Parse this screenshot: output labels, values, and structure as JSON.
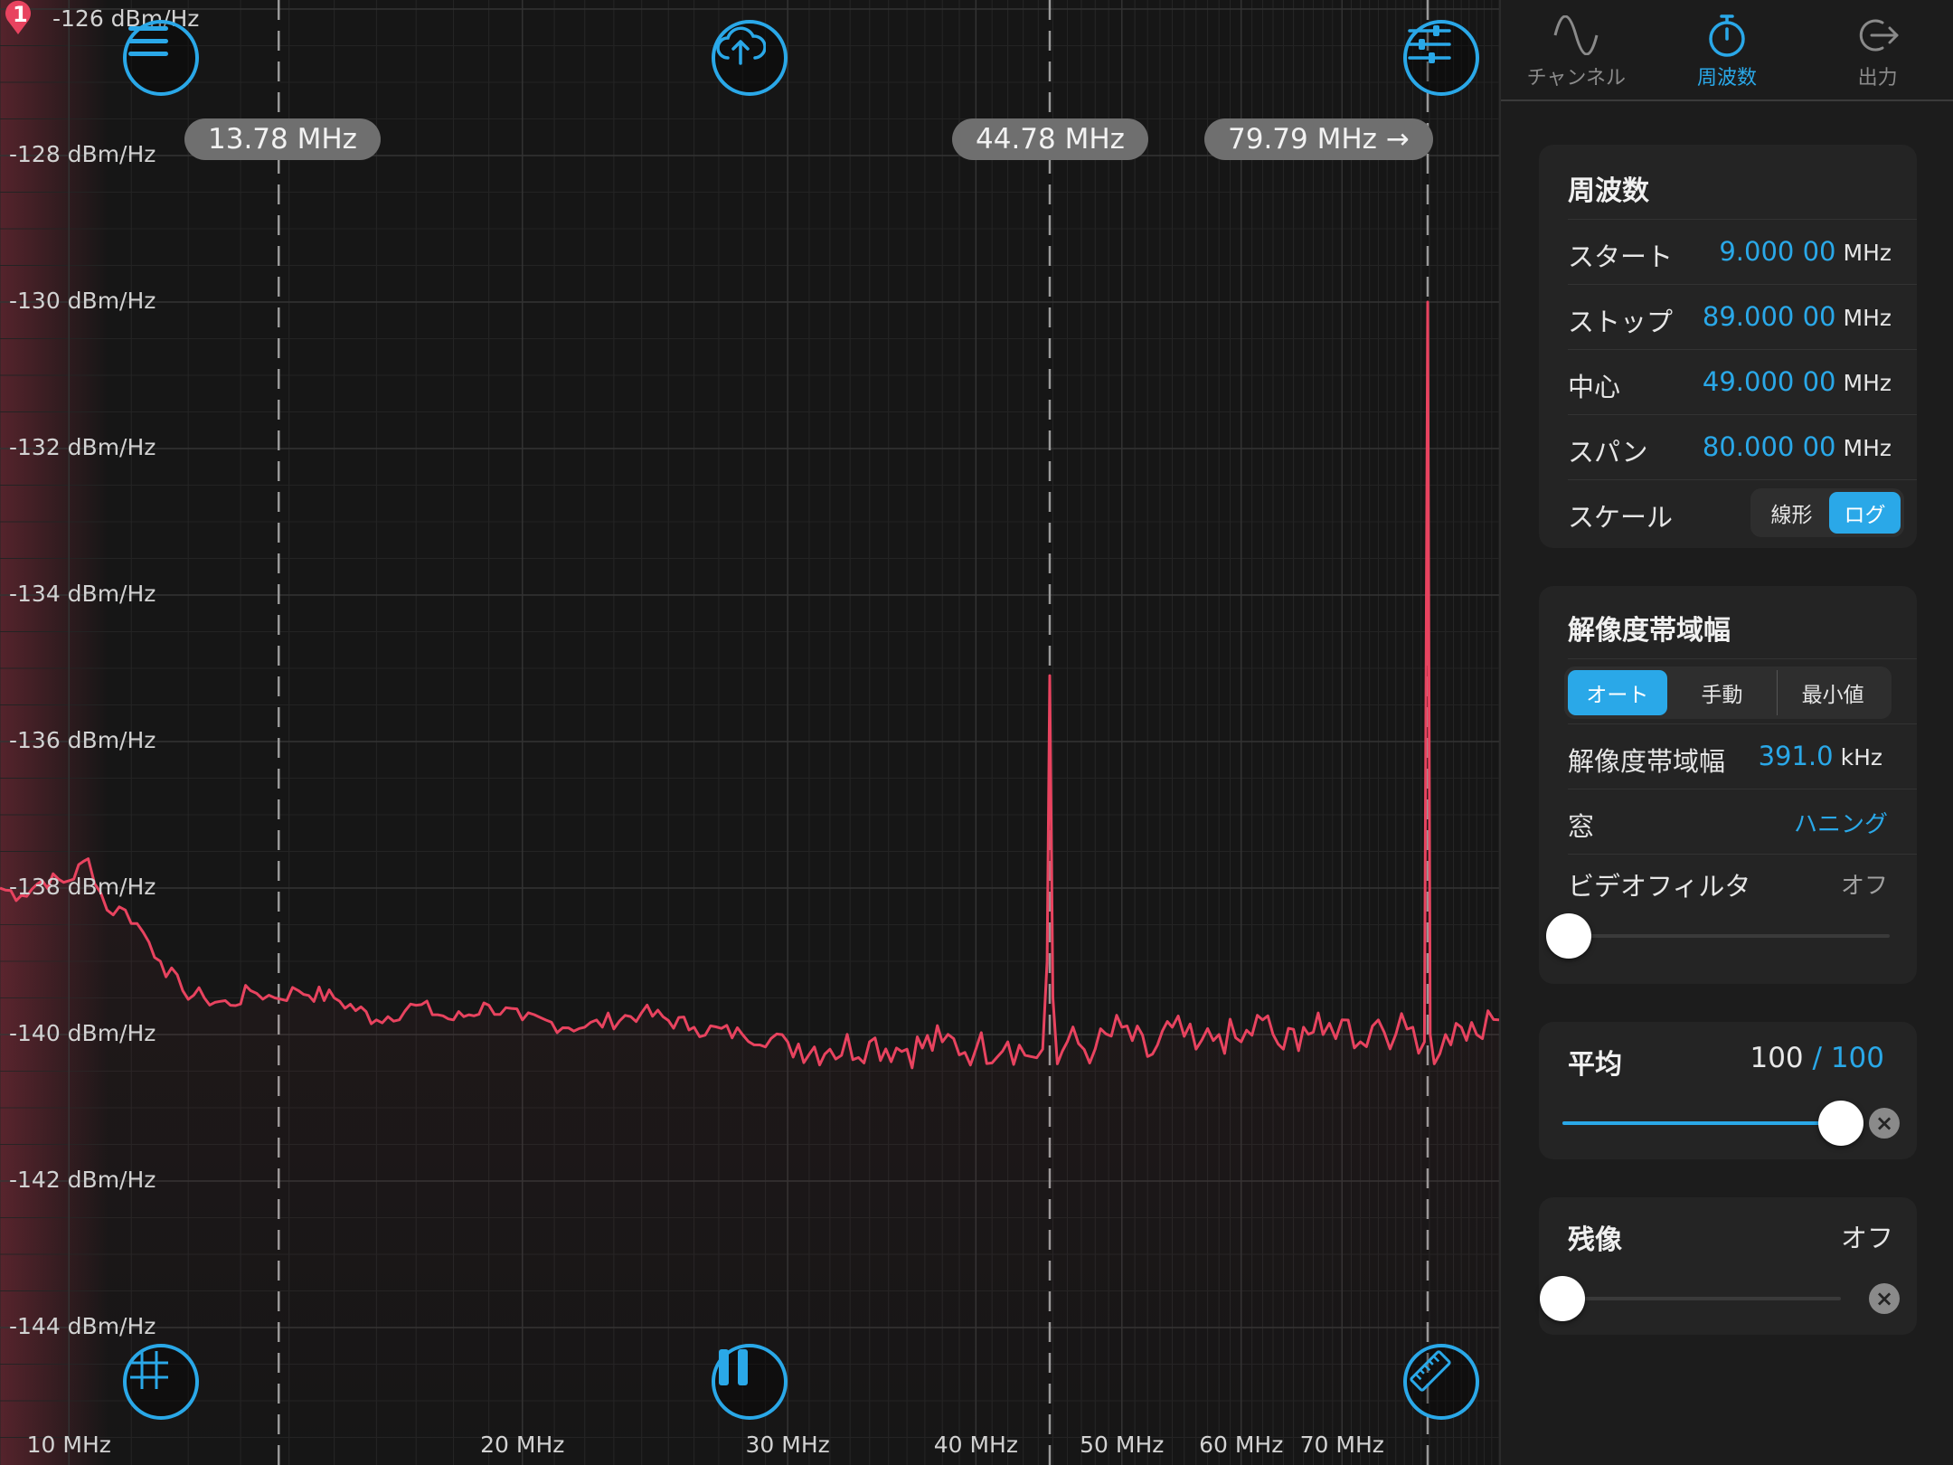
{
  "plot": {
    "top_reference": "-126 dBm/Hz",
    "marker_badge": "1",
    "y_ticks": [
      "-128 dBm/Hz",
      "-130 dBm/Hz",
      "-132 dBm/Hz",
      "-134 dBm/Hz",
      "-136 dBm/Hz",
      "-138 dBm/Hz",
      "-140 dBm/Hz",
      "-142 dBm/Hz",
      "-144 dBm/Hz"
    ],
    "x_ticks": [
      "10 MHz",
      "20 MHz",
      "30 MHz",
      "40 MHz",
      "50 MHz",
      "60 MHz",
      "70 MHz"
    ],
    "markers": [
      "13.78 MHz",
      "44.78 MHz",
      "79.79 MHz →"
    ],
    "trace_color": "#e8435f",
    "accent_color": "#2aa8e8",
    "icons": {
      "menu": "menu-icon",
      "upload": "cloud-upload-icon",
      "settings": "sliders-icon",
      "grid": "grid-icon",
      "pause": "pause-icon",
      "ruler": "ruler-icon"
    }
  },
  "chart_data": {
    "type": "line",
    "xscale": "log",
    "xlim": [
      9,
      89
    ],
    "ylim": [
      -145,
      -126
    ],
    "x_ticks": [
      10,
      20,
      30,
      40,
      50,
      60,
      70
    ],
    "y_ticks": [
      -128,
      -130,
      -132,
      -134,
      -136,
      -138,
      -140,
      -142,
      -144
    ],
    "markers_mhz": [
      13.78,
      44.78,
      79.79
    ],
    "series": [
      {
        "x": [
          9,
          9.3,
          9.6,
          10,
          10.3,
          10.6,
          10.9,
          11.2,
          11.5,
          11.9,
          12.3,
          12.8,
          13.2,
          13.7,
          14.2,
          15,
          16,
          17,
          18,
          19,
          20,
          22,
          24,
          26,
          28,
          30,
          32,
          34,
          36,
          38,
          40,
          42,
          43.5,
          44.3,
          44.6,
          44.78,
          45.0,
          45.3,
          46,
          48,
          50,
          52,
          54,
          56,
          58,
          60,
          62,
          64,
          66,
          68,
          70,
          72,
          74,
          76,
          78,
          79.4,
          79.79,
          80.1,
          80.6,
          82,
          84,
          86,
          89
        ],
        "y": [
          -138.0,
          -138.1,
          -137.9,
          -137.9,
          -137.6,
          -138.3,
          -138.3,
          -138.6,
          -139.0,
          -139.4,
          -139.5,
          -139.6,
          -139.4,
          -139.5,
          -139.4,
          -139.5,
          -139.8,
          -139.6,
          -139.8,
          -139.6,
          -139.8,
          -139.9,
          -139.7,
          -139.9,
          -140.0,
          -140.1,
          -140.2,
          -140.1,
          -140.2,
          -140.1,
          -140.2,
          -140.1,
          -140.3,
          -140.2,
          -139.0,
          -135.1,
          -139.5,
          -140.4,
          -140.1,
          -140.2,
          -139.9,
          -140.3,
          -139.9,
          -140.2,
          -140.0,
          -140.1,
          -139.8,
          -140.2,
          -139.9,
          -140.0,
          -139.8,
          -140.1,
          -139.8,
          -140.0,
          -139.9,
          -140.1,
          -130.0,
          -140.0,
          -140.4,
          -140.0,
          -139.9,
          -140.0,
          -139.8
        ]
      }
    ]
  },
  "panel": {
    "tabs": [
      {
        "label": "チャンネル",
        "icon": "sine-wave-icon"
      },
      {
        "label": "周波数",
        "icon": "stopwatch-icon"
      },
      {
        "label": "出力",
        "icon": "export-icon"
      }
    ],
    "frequency": {
      "title": "周波数",
      "start_label": "スタート",
      "start_value": "9.000 00",
      "start_unit": "MHz",
      "stop_label": "ストップ",
      "stop_value": "89.000 00",
      "stop_unit": "MHz",
      "center_label": "中心",
      "center_value": "49.000 00",
      "center_unit": "MHz",
      "span_label": "スパン",
      "span_value": "80.000 00",
      "span_unit": "MHz",
      "scale_label": "スケール",
      "scale_linear": "線形",
      "scale_log": "ログ"
    },
    "rbw": {
      "title": "解像度帯域幅",
      "mode_auto": "オート",
      "mode_manual": "手動",
      "mode_min": "最小値",
      "rbw_label": "解像度帯域幅",
      "rbw_value": "391.0",
      "rbw_unit": "kHz",
      "window_label": "窓",
      "window_value": "ハニング",
      "video_filter_label": "ビデオフィルタ",
      "video_filter_value": "オフ",
      "video_filter_level": 0
    },
    "average": {
      "title": "平均",
      "current": "100",
      "separator": "/",
      "max": "100",
      "level": 1.0
    },
    "persistence": {
      "title": "残像",
      "value": "オフ",
      "level": 0
    }
  }
}
